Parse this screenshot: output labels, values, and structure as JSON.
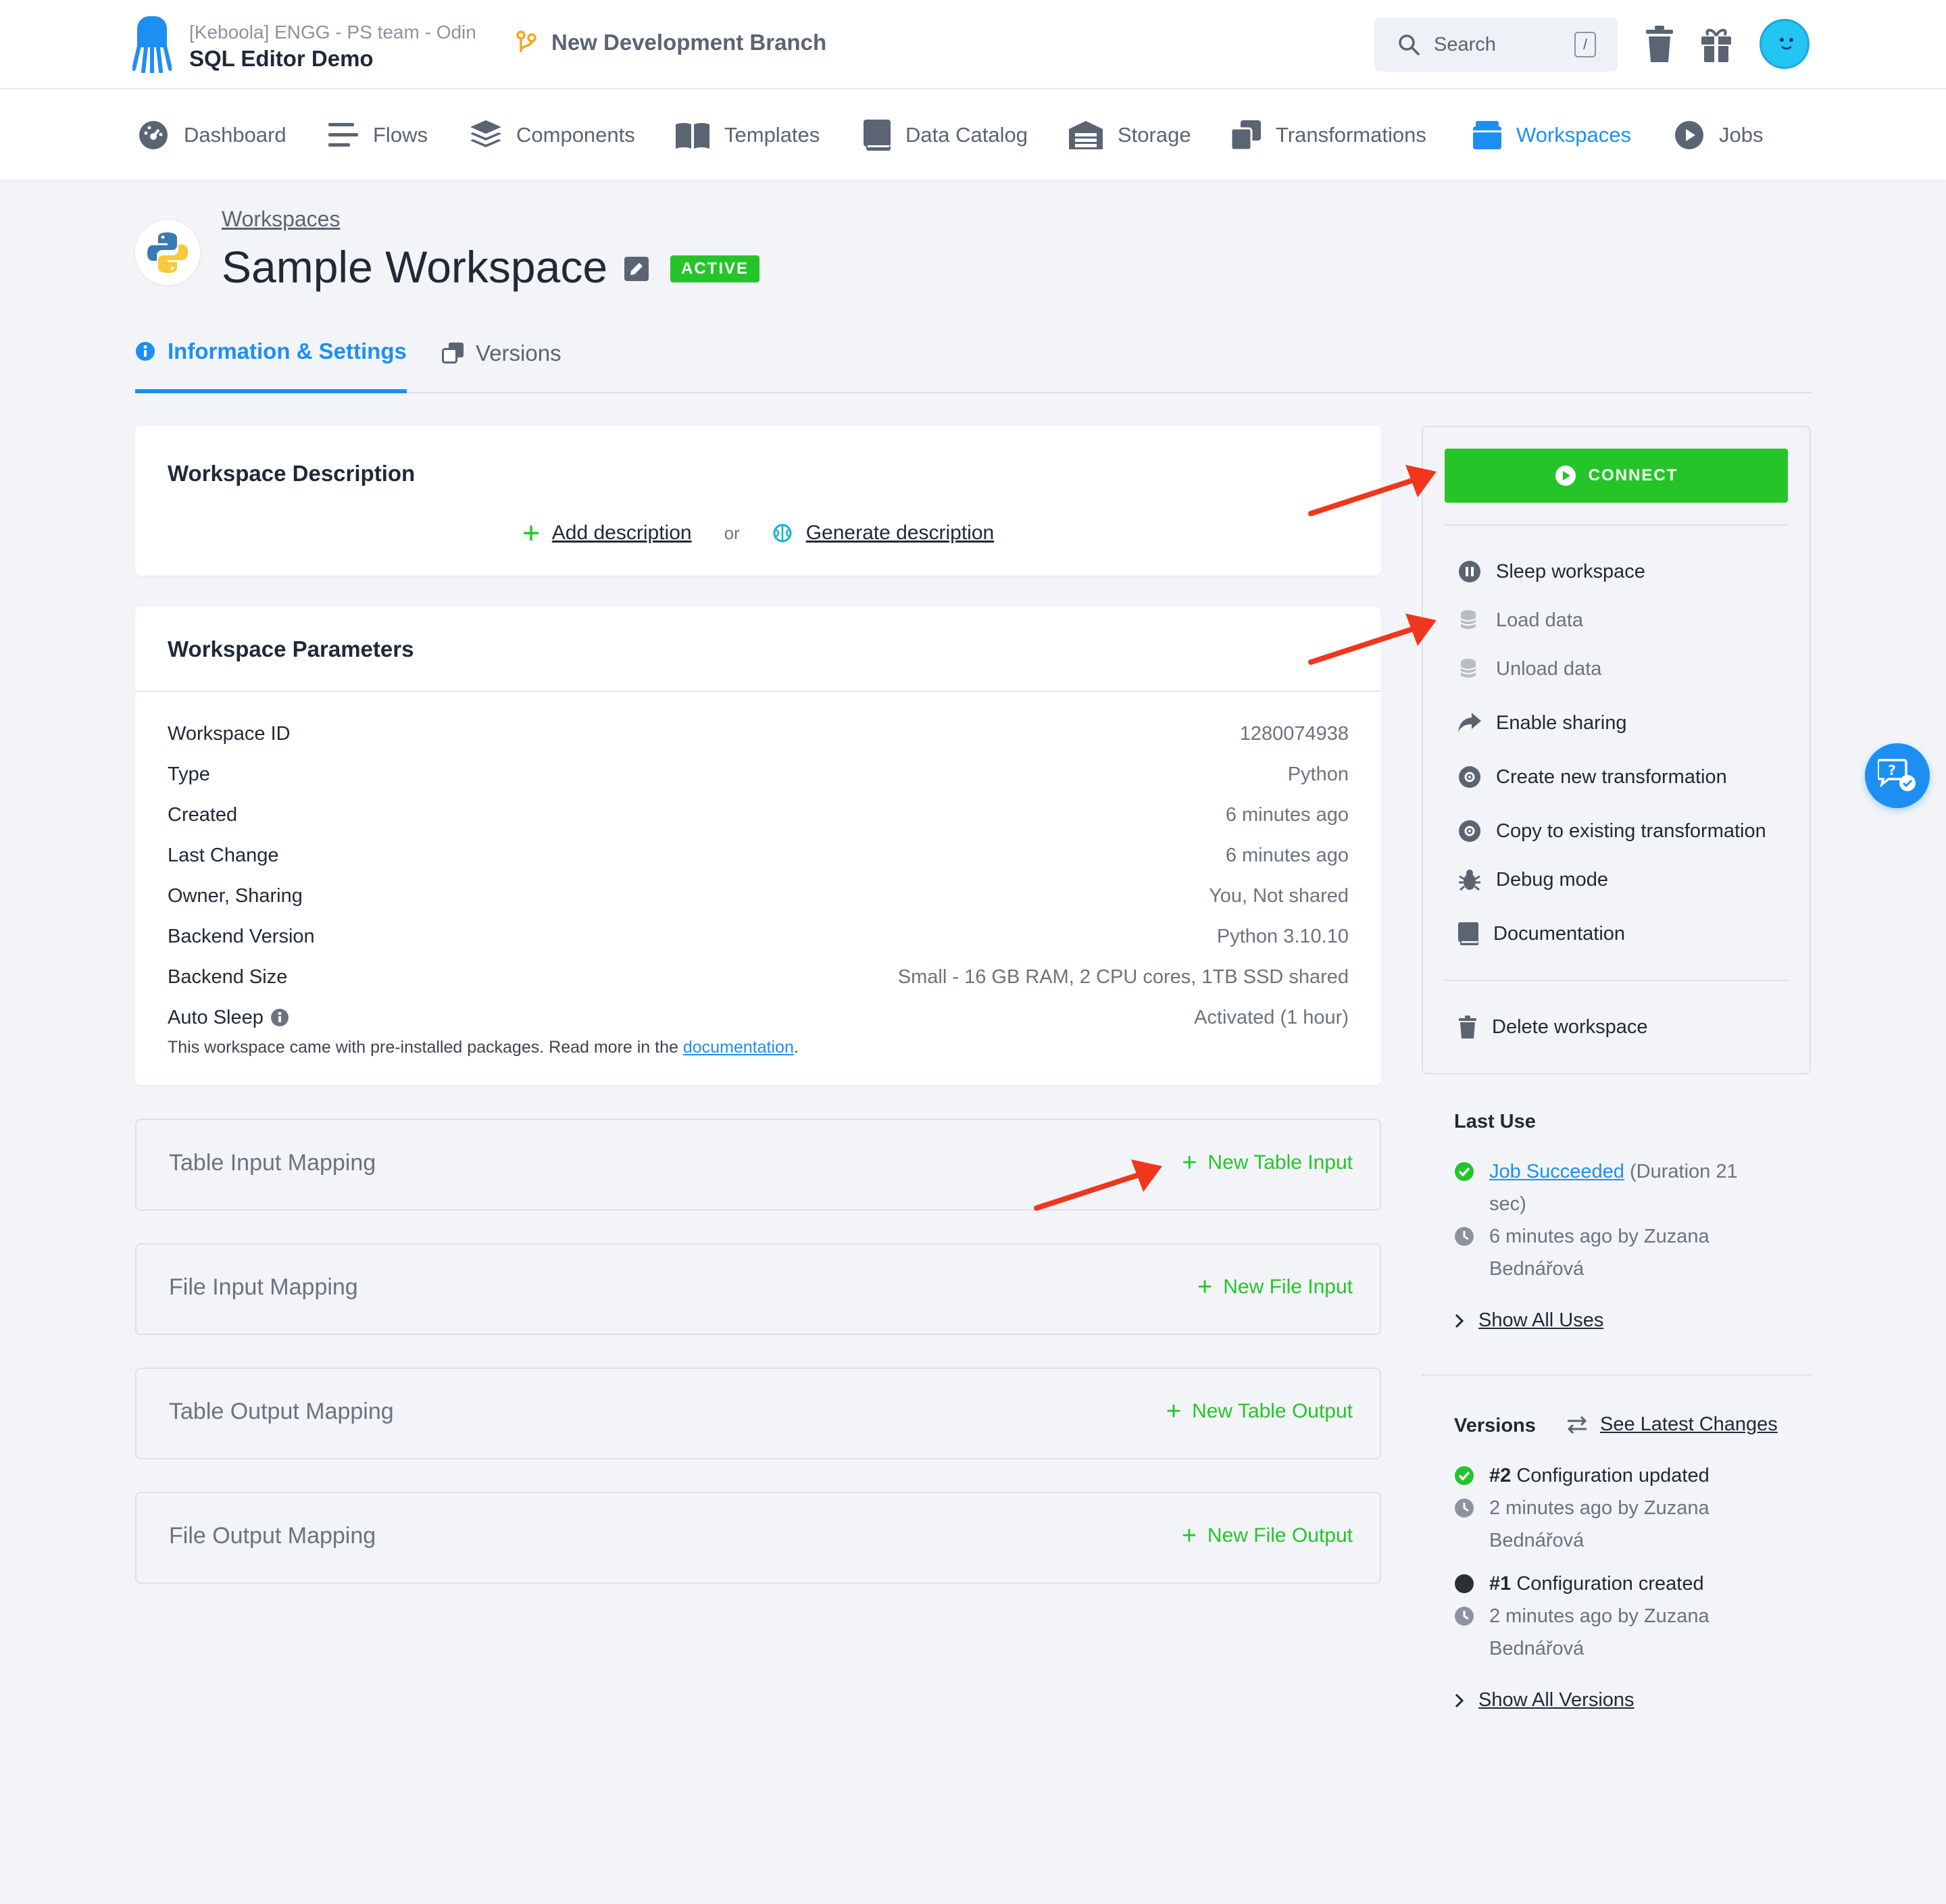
{
  "header": {
    "org": "[Keboola] ENGG - PS team - Odin",
    "project": "SQL Editor Demo",
    "branch": "New Development Branch",
    "search_placeholder": "Search",
    "search_shortcut": "/"
  },
  "nav": [
    {
      "label": "Dashboard"
    },
    {
      "label": "Flows"
    },
    {
      "label": "Components"
    },
    {
      "label": "Templates"
    },
    {
      "label": "Data Catalog"
    },
    {
      "label": "Storage"
    },
    {
      "label": "Transformations"
    },
    {
      "label": "Workspaces"
    },
    {
      "label": "Jobs"
    }
  ],
  "page": {
    "breadcrumb": "Workspaces",
    "title": "Sample Workspace",
    "status": "ACTIVE",
    "tabs": [
      {
        "label": "Information & Settings"
      },
      {
        "label": "Versions"
      }
    ]
  },
  "description": {
    "title": "Workspace Description",
    "add_label": "Add description",
    "or": "or",
    "generate_label": "Generate description"
  },
  "params": {
    "title": "Workspace Parameters",
    "rows": [
      {
        "key": "Workspace ID",
        "value": "1280074938"
      },
      {
        "key": "Type",
        "value": "Python"
      },
      {
        "key": "Created",
        "value": "6 minutes ago"
      },
      {
        "key": "Last Change",
        "value": "6 minutes ago"
      },
      {
        "key": "Owner, Sharing",
        "value": "You, Not shared"
      },
      {
        "key": "Backend Version",
        "value": "Python 3.10.10"
      },
      {
        "key": "Backend Size",
        "value": "Small - 16 GB RAM, 2 CPU cores, 1TB SSD shared"
      },
      {
        "key": "Auto Sleep",
        "value": "Activated (1 hour)"
      }
    ],
    "note_prefix": "This workspace came with pre-installed packages. Read more in the ",
    "note_link": "documentation",
    "note_suffix": "."
  },
  "mappings": [
    {
      "title": "Table Input Mapping",
      "action": "New Table Input"
    },
    {
      "title": "File Input Mapping",
      "action": "New File Input"
    },
    {
      "title": "Table Output Mapping",
      "action": "New Table Output"
    },
    {
      "title": "File Output Mapping",
      "action": "New File Output"
    }
  ],
  "sidebar": {
    "connect": "CONNECT",
    "actions": [
      {
        "label": "Sleep workspace"
      },
      {
        "label": "Load data"
      },
      {
        "label": "Unload data"
      },
      {
        "label": "Enable sharing"
      },
      {
        "label": "Create new transformation"
      },
      {
        "label": "Copy to existing transformation"
      },
      {
        "label": "Debug mode"
      },
      {
        "label": "Documentation"
      }
    ],
    "delete": "Delete workspace"
  },
  "last_use": {
    "title": "Last Use",
    "job_link": "Job Succeeded",
    "duration": " (Duration 21 sec)",
    "when": "6 minutes ago by Zuzana Bednářová",
    "show_all": "Show All Uses"
  },
  "versions": {
    "title": "Versions",
    "see_changes": "See Latest Changes",
    "items": [
      {
        "num": "#2",
        "desc": " Configuration updated",
        "when": "2 minutes ago by Zuzana Bednářová"
      },
      {
        "num": "#1",
        "desc": " Configuration created",
        "when": "2 minutes ago by Zuzana Bednářová"
      }
    ],
    "show_all": "Show All Versions"
  },
  "colors": {
    "accent": "#1d8ff2",
    "success": "#25c52a",
    "annotation_arrow": "#f0361c"
  }
}
